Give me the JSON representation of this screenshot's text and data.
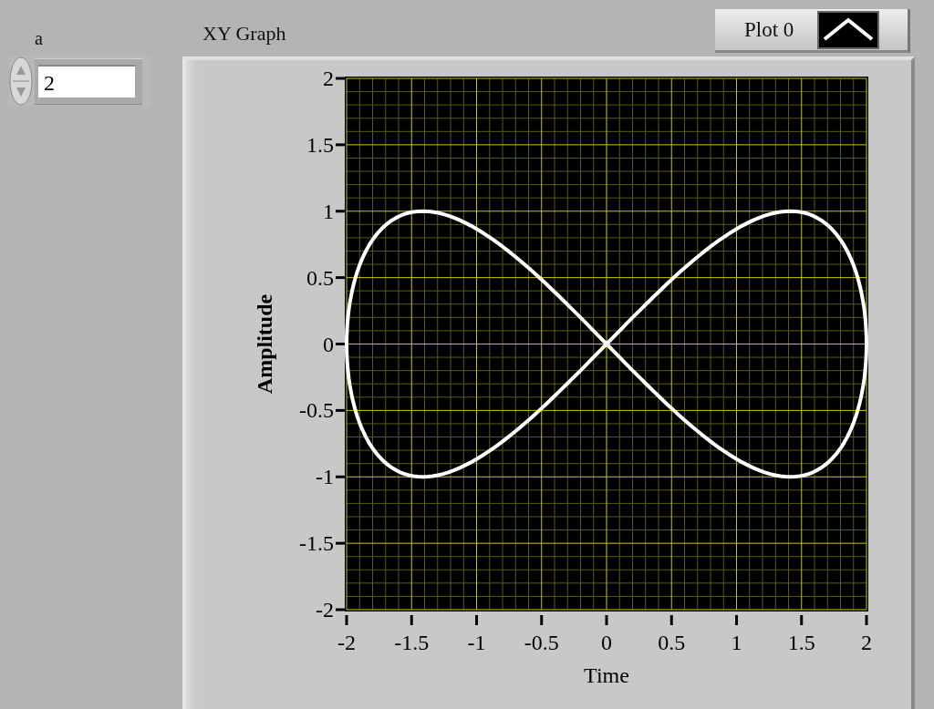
{
  "numeric_control": {
    "label": "a",
    "value": "2"
  },
  "xy_graph": {
    "label": "XY Graph",
    "legend": [
      {
        "name": "Plot 0"
      }
    ],
    "chart_data": {
      "type": "line",
      "grid": true,
      "xlabel": "Time",
      "ylabel": "Amplitude",
      "xlim": [
        -2,
        2
      ],
      "ylim": [
        -2,
        2
      ],
      "xticks": [
        -2,
        -1.5,
        -1,
        -0.5,
        0,
        0.5,
        1,
        1.5,
        2
      ],
      "yticks": [
        -2,
        -1.5,
        -1,
        -0.5,
        0,
        0.5,
        1,
        1.5,
        2
      ]
    }
  }
}
